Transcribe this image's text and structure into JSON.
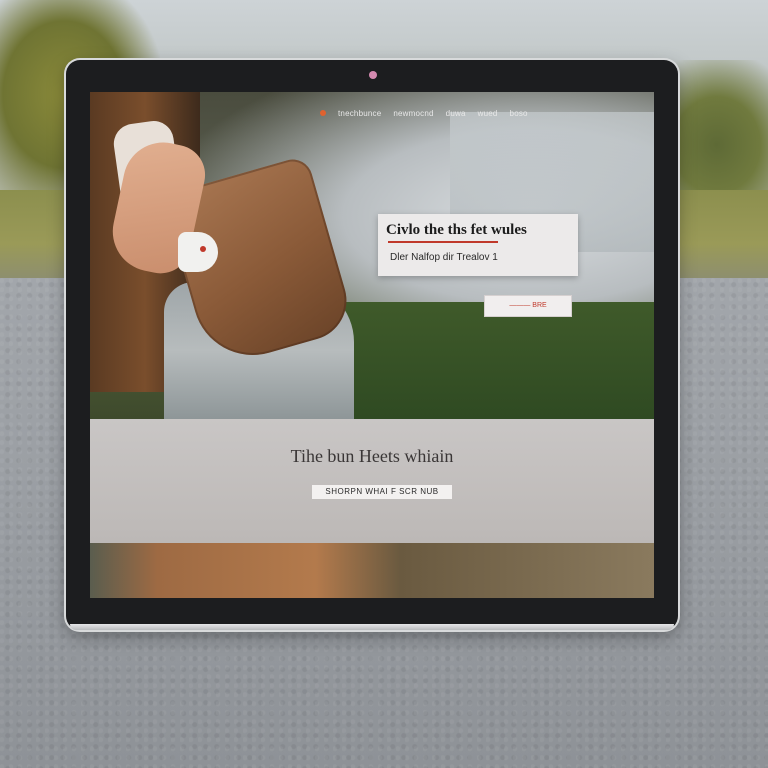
{
  "nav": {
    "items": [
      "tnechbunce",
      "newmocnd",
      "duwa",
      "wued",
      "boso"
    ]
  },
  "hero": {
    "card_title": "Civlo the ths fet wules",
    "card_subtitle": "Dler Nalfop dir Trealov 1",
    "cta_label": "——— BRE"
  },
  "band": {
    "heading": "Tihe bun Heets whiain",
    "button_label": "SHORPN WHAI F SCR NUB"
  },
  "colors": {
    "accent": "#c0392b",
    "tablet_frame": "#1c1d1f",
    "band_bg": "#c4c0be"
  }
}
